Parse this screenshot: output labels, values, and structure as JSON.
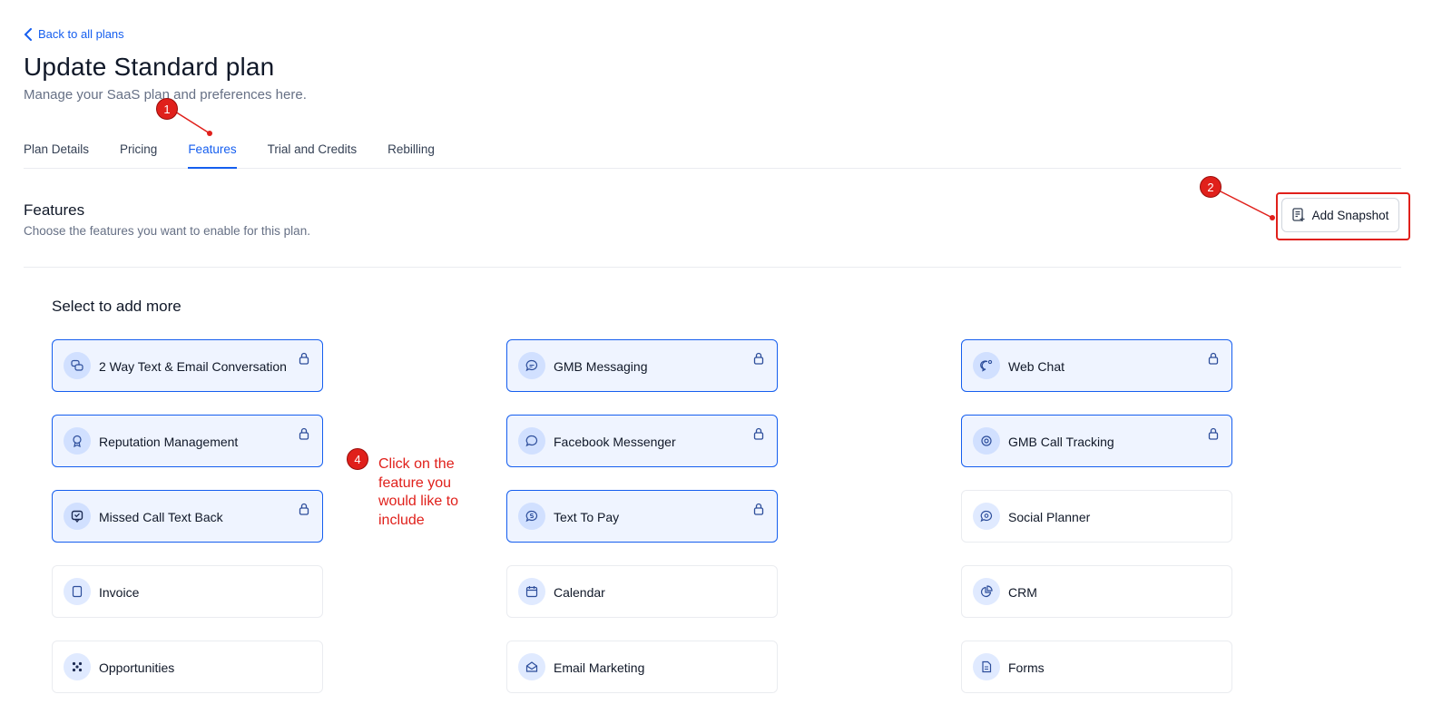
{
  "back_link": {
    "label": "Back to all plans",
    "icon": "chevron-left-icon"
  },
  "page": {
    "title": "Update Standard plan",
    "subtitle": "Manage your SaaS plan and preferences here."
  },
  "tabs": [
    {
      "label": "Plan Details",
      "active": false
    },
    {
      "label": "Pricing",
      "active": false
    },
    {
      "label": "Features",
      "active": true
    },
    {
      "label": "Trial and Credits",
      "active": false
    },
    {
      "label": "Rebilling",
      "active": false
    }
  ],
  "section": {
    "title": "Features",
    "description": "Choose the features you want to enable for this plan."
  },
  "snapshot_button": {
    "label": "Add Snapshot",
    "icon": "document-plus-icon"
  },
  "select_more_label": "Select to add more",
  "features": [
    {
      "label": "2 Way Text & Email Conversation",
      "selected": true,
      "icon": "chat-bubbles-icon"
    },
    {
      "label": "GMB Messaging",
      "selected": true,
      "icon": "message-icon"
    },
    {
      "label": "Web Chat",
      "selected": true,
      "icon": "web-chat-icon"
    },
    {
      "label": "Reputation Management",
      "selected": true,
      "icon": "award-icon"
    },
    {
      "label": "Facebook Messenger",
      "selected": true,
      "icon": "messenger-icon"
    },
    {
      "label": "GMB Call Tracking",
      "selected": true,
      "icon": "target-icon"
    },
    {
      "label": "Missed Call Text Back",
      "selected": true,
      "icon": "message-heart-icon"
    },
    {
      "label": "Text To Pay",
      "selected": true,
      "icon": "dollar-chat-icon"
    },
    {
      "label": "Social Planner",
      "selected": false,
      "icon": "social-icon"
    },
    {
      "label": "Invoice",
      "selected": false,
      "icon": "invoice-icon"
    },
    {
      "label": "Calendar",
      "selected": false,
      "icon": "calendar-icon"
    },
    {
      "label": "CRM",
      "selected": false,
      "icon": "pie-chart-icon"
    },
    {
      "label": "Opportunities",
      "selected": false,
      "icon": "grid-dots-icon"
    },
    {
      "label": "Email Marketing",
      "selected": false,
      "icon": "mail-icon"
    },
    {
      "label": "Forms",
      "selected": false,
      "icon": "form-icon"
    }
  ],
  "annotations": {
    "badge_1": "1",
    "badge_2": "2",
    "badge_4": "4",
    "note_4": "Click on the feature you would like to include",
    "color": "#E0201B"
  },
  "colors": {
    "accent": "#155EEF",
    "selected_bg": "#EFF4FF",
    "text_muted": "#667085"
  }
}
